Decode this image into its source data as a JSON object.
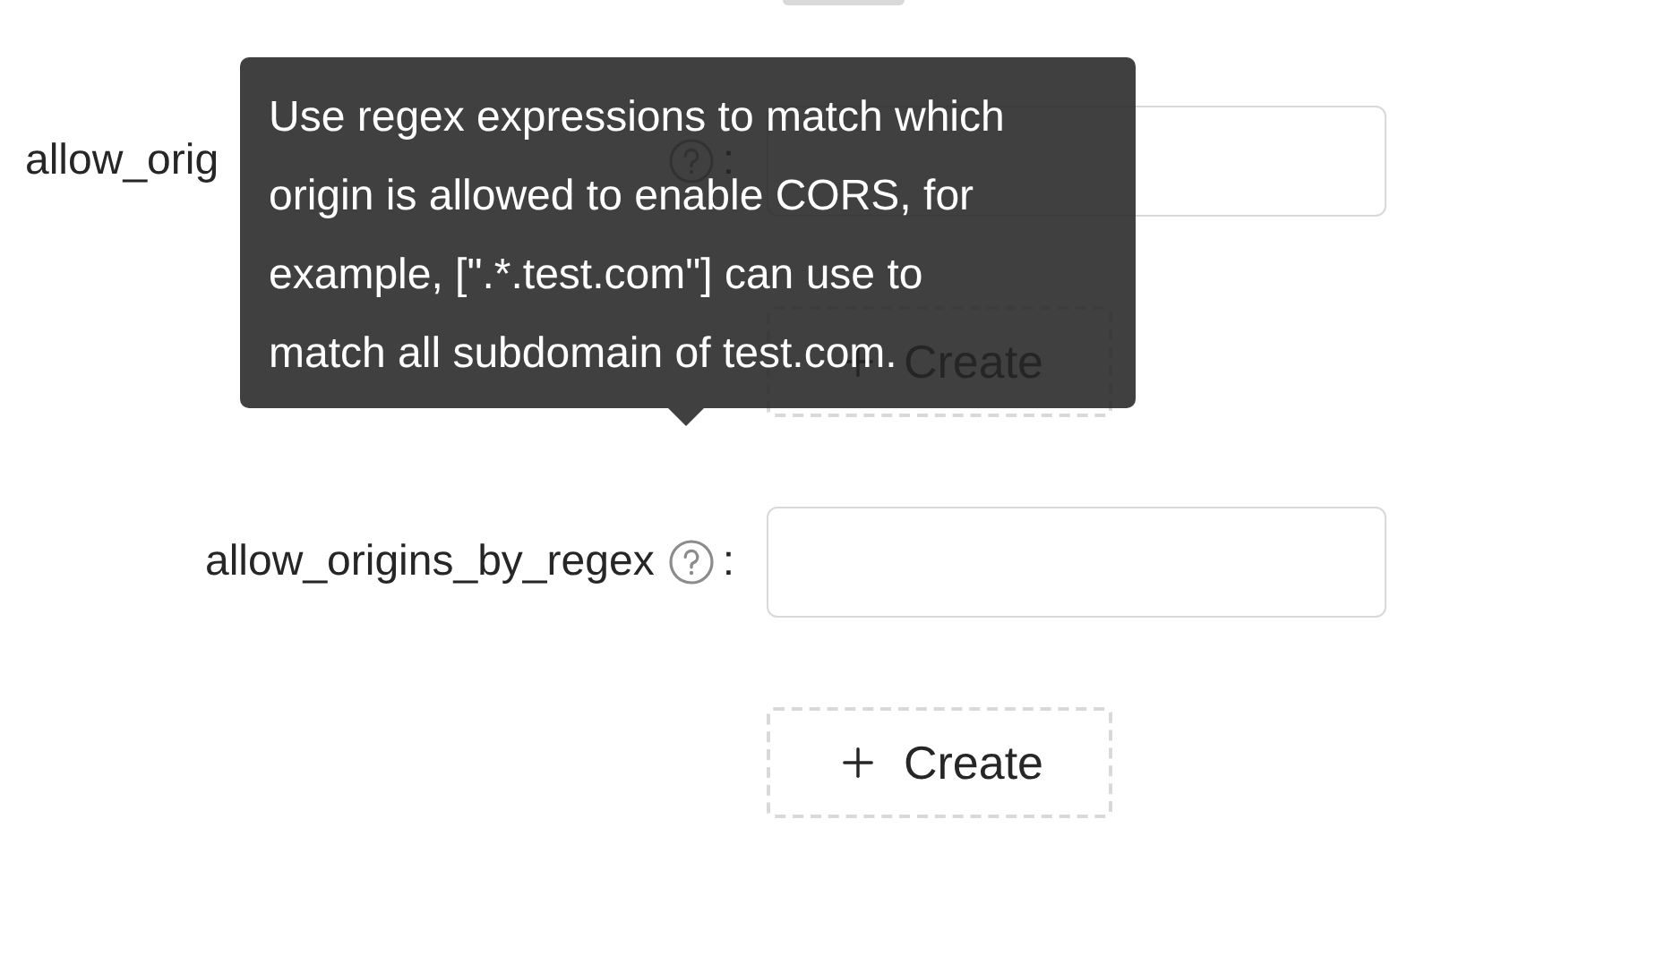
{
  "fields": [
    {
      "label": "allow_orig",
      "covered_by_tooltip": true,
      "label_suffix": ":",
      "create_button": "Create"
    },
    {
      "label": "allow_origins_by_regex",
      "label_suffix": ":",
      "create_button": "Create",
      "tooltip": "Use regex expressions to match which origin is allowed to enable CORS, for example, [\".*.test.com\"] can use to match all subdomain of test.com."
    }
  ]
}
